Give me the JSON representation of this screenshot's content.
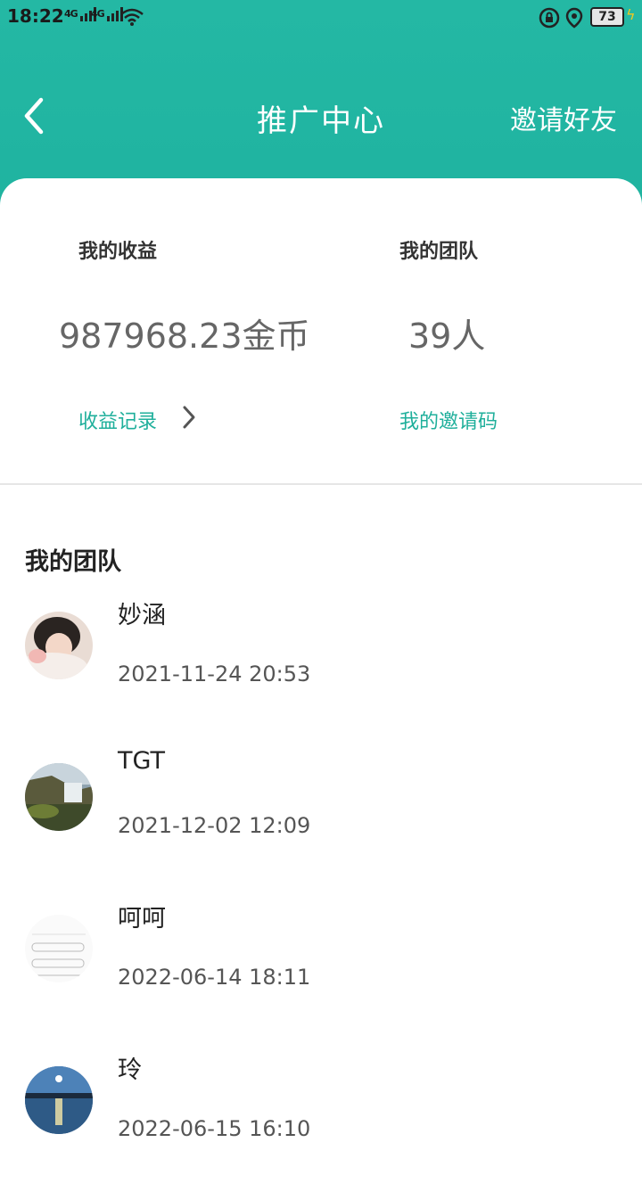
{
  "status_bar": {
    "time": "18:22",
    "signal1": "4G",
    "signal2": "4G",
    "battery": "73"
  },
  "header": {
    "title": "推广中心",
    "invite_label": "邀请好友"
  },
  "stats": {
    "earnings_label": "我的收益",
    "earnings_value": "987968.23金币",
    "earnings_link": "收益记录",
    "team_label": "我的团队",
    "team_value": "39人",
    "team_link": "我的邀请码"
  },
  "team": {
    "title": "我的团队",
    "members": [
      {
        "name": "妙涵",
        "time": "2021-11-24 20:53"
      },
      {
        "name": "TGT",
        "time": "2021-12-02 12:09"
      },
      {
        "name": "呵呵",
        "time": "2022-06-14 18:11"
      },
      {
        "name": "玲",
        "time": "2022-06-15 16:10"
      }
    ]
  },
  "colors": {
    "accent": "#1fb3a0",
    "link": "#1faf9b"
  }
}
